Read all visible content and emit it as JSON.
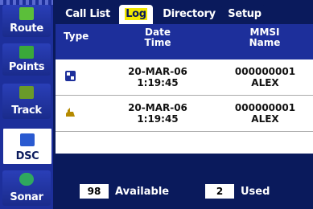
{
  "sidebar": {
    "items": [
      {
        "label": "Route"
      },
      {
        "label": "Points"
      },
      {
        "label": "Track"
      },
      {
        "label": "DSC"
      },
      {
        "label": "Sonar"
      }
    ]
  },
  "tabs": [
    {
      "label": "Call List"
    },
    {
      "label": "Log"
    },
    {
      "label": "Directory"
    },
    {
      "label": "Setup"
    }
  ],
  "header": {
    "type": "Type",
    "date": "Date",
    "time": "Time",
    "mmsi": "MMSI",
    "name": "Name"
  },
  "rows": [
    {
      "icon": "dsc-distress-icon",
      "date": "20-MAR-06",
      "time": "1:19:45",
      "mmsi": "000000001",
      "name": "ALEX"
    },
    {
      "icon": "dsc-position-icon",
      "date": "20-MAR-06",
      "time": "1:19:45",
      "mmsi": "000000001",
      "name": "ALEX"
    }
  ],
  "footer": {
    "available_count": "98",
    "available_label": "Available",
    "used_count": "2",
    "used_label": "Used"
  }
}
